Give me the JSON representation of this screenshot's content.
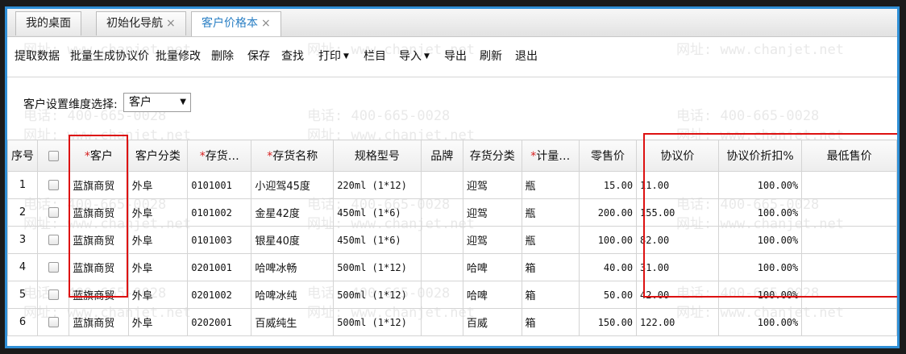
{
  "tabs": [
    {
      "label": "我的桌面",
      "closable": false,
      "active": false
    },
    {
      "label": "初始化导航",
      "closable": true,
      "active": false
    },
    {
      "label": "客户价格本",
      "closable": true,
      "active": true
    }
  ],
  "close_glyph": "×",
  "toolbar": [
    {
      "label": "提取数据",
      "dropdown": false
    },
    {
      "label": "批量生成协议价",
      "dropdown": false
    },
    {
      "label": "批量修改",
      "dropdown": false
    },
    {
      "label": "删除",
      "dropdown": false
    },
    {
      "label": "保存",
      "dropdown": false
    },
    {
      "label": "查找",
      "dropdown": false
    },
    {
      "label": "打印",
      "dropdown": true
    },
    {
      "label": "栏目",
      "dropdown": false
    },
    {
      "label": "导入",
      "dropdown": true
    },
    {
      "label": "导出",
      "dropdown": false
    },
    {
      "label": "刷新",
      "dropdown": false
    },
    {
      "label": "退出",
      "dropdown": false
    }
  ],
  "filter": {
    "label": "客户设置维度选择:",
    "value": "客户"
  },
  "watermark": {
    "phone": "电话: 400-665-0028",
    "site": "网址: www.chanjet.net"
  },
  "columns": [
    {
      "label": "序号",
      "required": false
    },
    {
      "label": "",
      "required": false
    },
    {
      "label": "客户",
      "required": true
    },
    {
      "label": "客户分类",
      "required": false
    },
    {
      "label": "存货…",
      "required": true
    },
    {
      "label": "存货名称",
      "required": true
    },
    {
      "label": "规格型号",
      "required": false
    },
    {
      "label": "品牌",
      "required": false
    },
    {
      "label": "存货分类",
      "required": false
    },
    {
      "label": "计量…",
      "required": true
    },
    {
      "label": "零售价",
      "required": false
    },
    {
      "label": "协议价",
      "required": false
    },
    {
      "label": "协议价折扣%",
      "required": false
    },
    {
      "label": "最低售价",
      "required": false
    }
  ],
  "rows": [
    {
      "seq": "1",
      "customer": "蓝旗商贸",
      "cust_cat": "外阜",
      "code": "0101001",
      "name": "小迎驾45度",
      "spec": "220ml (1*12)",
      "brand": "",
      "cat": "迎驾",
      "unit": "瓶",
      "retail": "15.00",
      "price": "11.00",
      "discount": "100.00%",
      "min": ""
    },
    {
      "seq": "2",
      "customer": "蓝旗商贸",
      "cust_cat": "外阜",
      "code": "0101002",
      "name": "金星42度",
      "spec": "450ml (1*6)",
      "brand": "",
      "cat": "迎驾",
      "unit": "瓶",
      "retail": "200.00",
      "price": "155.00",
      "discount": "100.00%",
      "min": ""
    },
    {
      "seq": "3",
      "customer": "蓝旗商贸",
      "cust_cat": "外阜",
      "code": "0101003",
      "name": "银星40度",
      "spec": "450ml (1*6)",
      "brand": "",
      "cat": "迎驾",
      "unit": "瓶",
      "retail": "100.00",
      "price": "82.00",
      "discount": "100.00%",
      "min": ""
    },
    {
      "seq": "4",
      "customer": "蓝旗商贸",
      "cust_cat": "外阜",
      "code": "0201001",
      "name": "哈啤冰畅",
      "spec": "500ml (1*12)",
      "brand": "",
      "cat": "哈啤",
      "unit": "箱",
      "retail": "40.00",
      "price": "31.00",
      "discount": "100.00%",
      "min": ""
    },
    {
      "seq": "5",
      "customer": "蓝旗商贸",
      "cust_cat": "外阜",
      "code": "0201002",
      "name": "哈啤冰纯",
      "spec": "500ml (1*12)",
      "brand": "",
      "cat": "哈啤",
      "unit": "箱",
      "retail": "50.00",
      "price": "42.00",
      "discount": "100.00%",
      "min": ""
    },
    {
      "seq": "6",
      "customer": "蓝旗商贸",
      "cust_cat": "外阜",
      "code": "0202001",
      "name": "百威纯生",
      "spec": "500ml (1*12)",
      "brand": "",
      "cat": "百威",
      "unit": "箱",
      "retail": "150.00",
      "price": "122.00",
      "discount": "100.00%",
      "min": ""
    }
  ],
  "colors": {
    "accent": "#2f8fd6",
    "highlight": "#dd1111",
    "required": "#d62020"
  }
}
